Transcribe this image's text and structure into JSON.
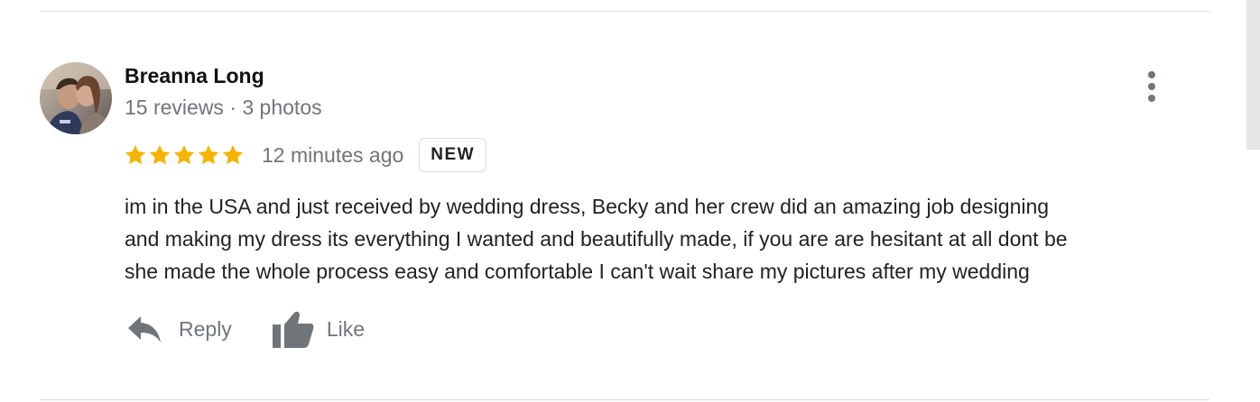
{
  "review": {
    "author": {
      "name": "Breanna Long",
      "meta": "15 reviews · 3 photos",
      "avatar_icon": "user-photo-avatar"
    },
    "rating": {
      "stars": 5,
      "max_stars": 5,
      "star_color": "#f4b400"
    },
    "timestamp": "12 minutes ago",
    "badge": "NEW",
    "text_lines": [
      "im in the USA and just received by wedding dress, Becky and her crew did an amazing job designing",
      "and making my dress its everything I wanted and beautifully made, if you are are hesitant at all dont be",
      "she made the whole process easy and comfortable I can't wait share my pictures after my wedding"
    ],
    "actions": {
      "reply_label": "Reply",
      "reply_icon": "reply-arrow-icon",
      "like_label": "Like",
      "like_icon": "thumbs-up-icon"
    },
    "menu_icon": "more-vertical-icon"
  },
  "colors": {
    "secondary_text": "#70757a",
    "primary_text": "#222222",
    "divider": "#dadce0",
    "icon": "#70757a"
  }
}
